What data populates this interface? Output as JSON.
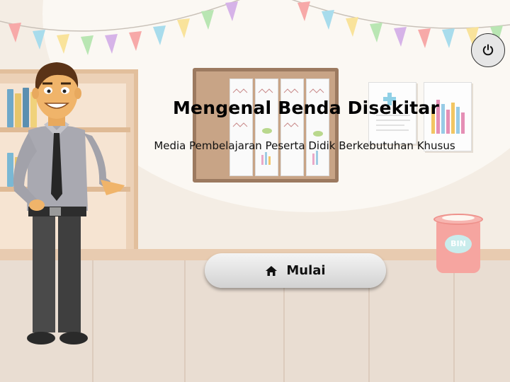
{
  "screen": {
    "title": "Mengenal Benda Disekitar",
    "subtitle": "Media Pembelajaran Peserta Didik Berkebutuhan Khusus"
  },
  "start_button": {
    "label": "Mulai",
    "icon": "home-icon"
  },
  "power_button": {
    "icon": "power-icon"
  },
  "trash_bin": {
    "label": "BIN"
  },
  "colors": {
    "wall": "#f4ede4",
    "floor": "#e9ddd2",
    "button": "#e0e0e0",
    "bin": "#f6a5a0",
    "bunting": [
      "#f7a9a8",
      "#a8dcec",
      "#f9e39b",
      "#b9e6b3",
      "#d6b3e8"
    ]
  }
}
